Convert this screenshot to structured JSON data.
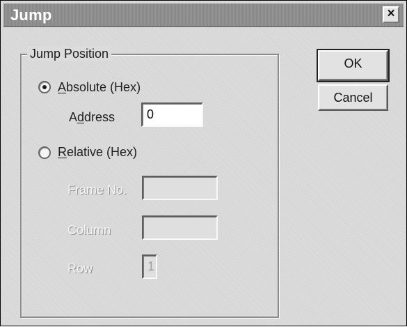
{
  "window": {
    "title": "Jump",
    "close_glyph": "×"
  },
  "group": {
    "label": "Jump Position"
  },
  "options": {
    "absolute": {
      "label_prefix": "A",
      "label_rest": "bsolute (Hex)",
      "selected": true
    },
    "relative": {
      "label_prefix": "R",
      "label_rest": "elative (Hex)",
      "selected": false
    }
  },
  "fields": {
    "address_label_prefix": "A",
    "address_label_mnemonic": "d",
    "address_label_rest": "dress",
    "address_value": "0",
    "frame_label": "Frame No.",
    "frame_value": "",
    "column_label": "Column",
    "column_value": "",
    "row_label": "Row",
    "row_value": "1"
  },
  "buttons": {
    "ok": "OK",
    "cancel": "Cancel"
  },
  "colors": {
    "dialog_bg": "#dcdcdc",
    "title_bg": "#8e8e8e",
    "text": "#202020",
    "disabled_text": "#f6f6f6"
  },
  "icons": {
    "close": "close-icon",
    "radio_selected": "radio-selected-icon",
    "radio_unselected": "radio-unselected-icon"
  }
}
